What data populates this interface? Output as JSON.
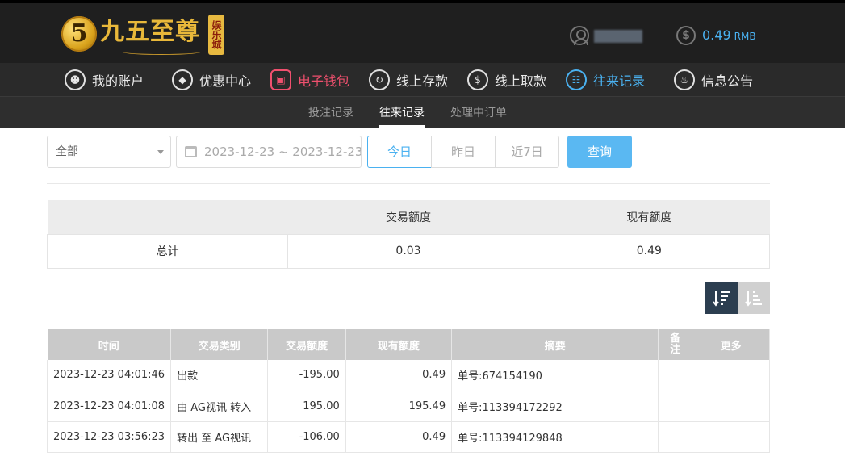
{
  "brand": {
    "logo_digit": "5",
    "logo_text": "九五至尊",
    "logo_badge": "娱乐城"
  },
  "account": {
    "balance": "0.49",
    "currency": "RMB"
  },
  "nav": [
    {
      "label": "我的账户",
      "icon": "user-icon"
    },
    {
      "label": "优惠中心",
      "icon": "gift-icon"
    },
    {
      "label": "电子钱包",
      "icon": "wallet-icon"
    },
    {
      "label": "线上存款",
      "icon": "deposit-icon"
    },
    {
      "label": "线上取款",
      "icon": "withdraw-icon"
    },
    {
      "label": "往来记录",
      "icon": "records-icon"
    },
    {
      "label": "信息公告",
      "icon": "bell-icon"
    }
  ],
  "subnav": [
    {
      "label": "投注记录"
    },
    {
      "label": "往来记录"
    },
    {
      "label": "处理中订单"
    }
  ],
  "filters": {
    "type_select": "全部",
    "date_range": "2023-12-23 ~ 2023-12-23",
    "today": "今日",
    "yesterday": "昨日",
    "last7": "近7日",
    "query": "查询"
  },
  "summary": {
    "headers": [
      "",
      "交易额度",
      "现有额度"
    ],
    "row": [
      "总计",
      "0.03",
      "0.49"
    ]
  },
  "records": {
    "headers": [
      "时间",
      "交易类别",
      "交易额度",
      "现有额度",
      "摘要",
      "备注",
      "更多"
    ],
    "rows": [
      [
        "2023-12-23 04:01:46",
        "出款",
        "-195.00",
        "0.49",
        "单号:674154190",
        "",
        ""
      ],
      [
        "2023-12-23 04:01:08",
        "由 AG视讯 转入",
        "195.00",
        "195.49",
        "单号:113394172292",
        "",
        ""
      ],
      [
        "2023-12-23 03:56:23",
        "转出 至 AG视讯",
        "-106.00",
        "0.49",
        "单号:113394129848",
        "",
        ""
      ]
    ]
  },
  "colors": {
    "accent": "#4ab1f0",
    "wallet_red": "#f0506e",
    "header_bg": "#1f1f1f",
    "nav_bg": "#2a2a2a"
  }
}
